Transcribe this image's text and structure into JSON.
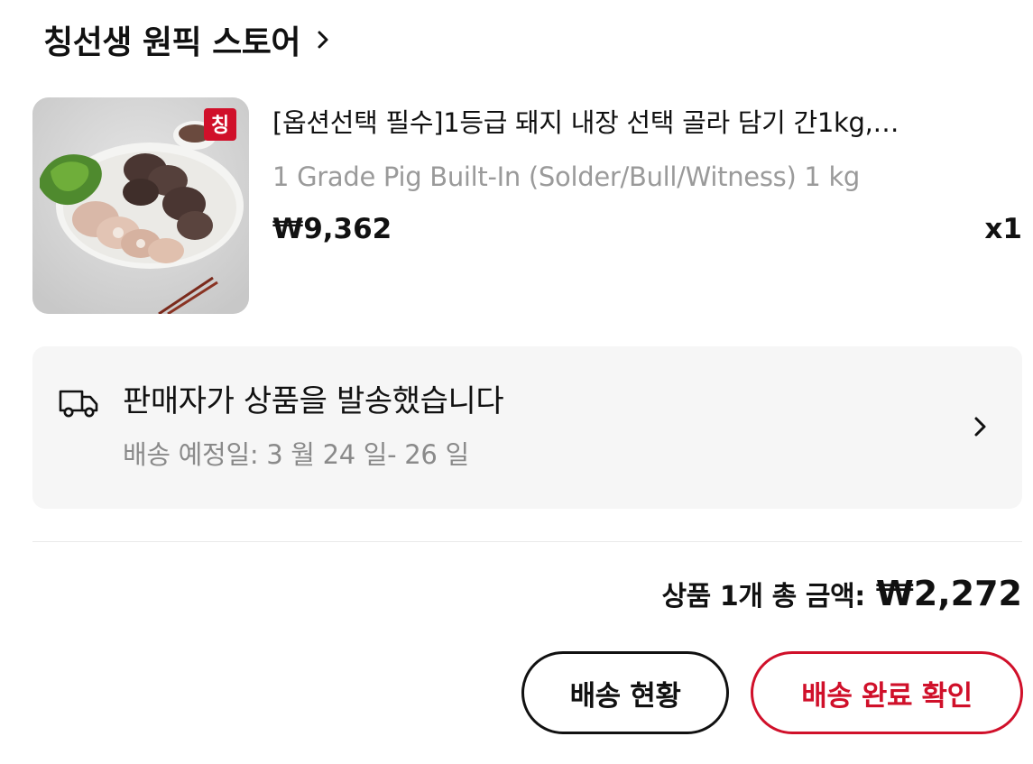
{
  "store": {
    "name": "칭선생 원픽 스토어",
    "chevron_icon": "chevron-right-icon"
  },
  "product": {
    "image_icon": "product-photo-pork-offal-platter",
    "logo_text": "칭",
    "title": "[옵션선택 필수]1등급 돼지 내장 선택 골라 담기 간1kg,…",
    "subtitle": "1 Grade Pig Built-In (Solder/Bull/Witness) 1 kg",
    "price": "₩9,362",
    "quantity": "x1"
  },
  "shipping": {
    "icon": "delivery-truck-icon",
    "status": "판매자가 상품을 발송했습니다",
    "eta": "배송 예정일: 3 월 24 일- 26 일",
    "chevron_icon": "chevron-right-icon"
  },
  "summary": {
    "total_label": "상품 1개 총 금액:",
    "total_amount": "₩2,272"
  },
  "actions": {
    "track_label": "배송 현황",
    "confirm_label": "배송 완료 확인"
  },
  "colors": {
    "accent_red": "#d0102a",
    "card_bg": "#f6f6f6",
    "muted_text": "#8a8a8a",
    "primary_text": "#111111"
  }
}
